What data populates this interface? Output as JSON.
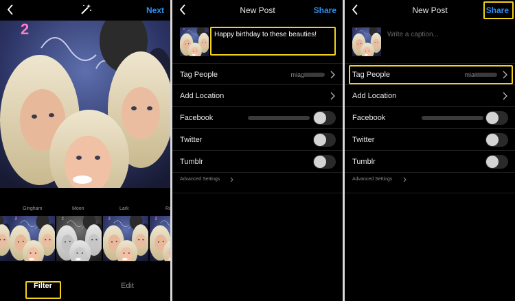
{
  "panel1": {
    "next_label": "Next",
    "filters": [
      "Gingham",
      "Moon",
      "Lark",
      "Re"
    ],
    "tabs": {
      "filter": "Filter",
      "edit": "Edit"
    }
  },
  "panel2": {
    "title": "New Post",
    "share_label": "Share",
    "caption": "Happy birthday to these beauties!",
    "rows": {
      "tag_people": "Tag People",
      "tag_value": "miag",
      "add_location": "Add Location",
      "facebook": "Facebook",
      "twitter": "Twitter",
      "tumblr": "Tumblr"
    },
    "advanced": "Advanced Settings"
  },
  "panel3": {
    "title": "New Post",
    "share_label": "Share",
    "caption_placeholder": "Write a caption...",
    "rows": {
      "tag_people": "Tag People",
      "tag_value": "mia",
      "add_location": "Add Location",
      "facebook": "Facebook",
      "twitter": "Twitter",
      "tumblr": "Tumblr"
    },
    "advanced": "Advanced Settings"
  },
  "colors": {
    "accent": "#2f8ff0",
    "highlight": "#f2d21b",
    "background": "#000000"
  },
  "icons": [
    "back-chevron-icon",
    "magic-wand-icon",
    "chevron-right-icon"
  ]
}
